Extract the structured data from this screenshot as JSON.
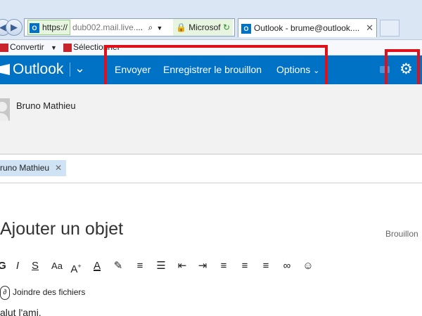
{
  "browser": {
    "address_prefix": "https://",
    "address_host": "dub002.mail.live.",
    "address_ellipsis": "...",
    "cert_label": "Microsof",
    "tab_title": "Outlook - brume@outlook....",
    "toolbar_convert": "Convertir",
    "toolbar_select": "Sélectionner"
  },
  "outlook": {
    "logo_text": "Outlook",
    "send_label": "Envoyer",
    "save_draft_label": "Enregistrer le brouillon",
    "options_label": "Options",
    "accent_color": "#0072c6",
    "highlight_color": "#e0101a"
  },
  "compose": {
    "sender_name": "Bruno Mathieu",
    "recipient_chip": "runo Mathieu",
    "subject_placeholder": "Ajouter un objet",
    "draft_status": "Brouillon",
    "attach_label": "Joindre des fichiers",
    "body_text": "alut l'ami,"
  },
  "format_toolbar": {
    "bold": "G",
    "italic": "I",
    "underline": "S",
    "font_size": "Aa",
    "grow_font": "A",
    "font_color": "A",
    "highlight": "✎",
    "numbered_list": "≡",
    "bullets": "☰",
    "outdent": "⇤",
    "indent": "⇥",
    "align_left": "≡",
    "align_center": "≡",
    "align_right": "≡",
    "link": "∞",
    "emoji": "☺"
  }
}
